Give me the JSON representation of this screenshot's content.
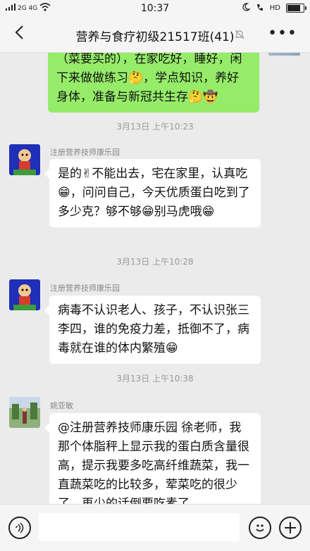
{
  "status_bar": {
    "signal": "2G 4G",
    "time": "10:37",
    "hd": "HD"
  },
  "nav": {
    "title": "营养与食疗初级21517班(41)",
    "more": "•••"
  },
  "messages": [
    {
      "type": "outgoing",
      "text": "（菜要买的），在家吃好，睡好，闲下来做做练习🤔，学点知识，养好身体，准备与新冠共生存🤔🤠"
    },
    {
      "type": "timestamp",
      "text": "3月13日 上午10:23"
    },
    {
      "type": "incoming",
      "sender": "注册营养技师康乐园",
      "text": "是的✌不能出去，宅在家里，认真吃😁，问问自己，今天优质蛋白吃到了多少克？够不够😁别马虎哦😁"
    },
    {
      "type": "timestamp",
      "text": "3月13日 上午10:28"
    },
    {
      "type": "incoming",
      "sender": "注册营养技师康乐园",
      "text": "病毒不认识老人、孩子，不认识张三李四，谁的免疫力差，抵御不了，病毒就在谁的体内繁殖😁"
    },
    {
      "type": "timestamp",
      "text": "3月13日 上午10:38"
    },
    {
      "type": "incoming",
      "sender": "姚亚敏",
      "text": "@注册营养技师康乐园  徐老师，我那个体脂秤上显示我的蛋白质含量很高，提示我要多吃高纤维蔬菜，我一直蔬菜吃的比较多，荤菜吃的很少了，再少的话倒要吃素了"
    }
  ],
  "input_bar": {
    "placeholder": ""
  },
  "colors": {
    "outgoing_bubble": "#95ec69",
    "incoming_bubble": "#ffffff",
    "background": "#ebebeb"
  }
}
